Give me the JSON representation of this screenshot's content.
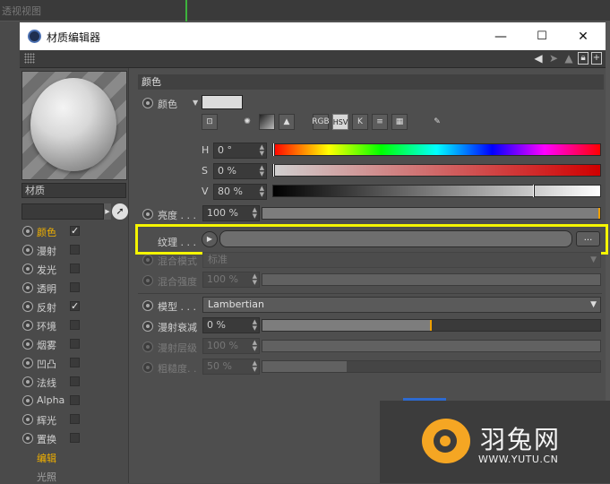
{
  "background": {
    "viewport_label": "透视视图"
  },
  "window": {
    "title": "材质编辑器",
    "controls": {
      "minimize": "—",
      "maximize": "☐",
      "close": "✕"
    }
  },
  "left_panel": {
    "material_name": "材质",
    "channels": [
      {
        "label": "颜色",
        "checked": true,
        "active": true
      },
      {
        "label": "漫射",
        "checked": false
      },
      {
        "label": "发光",
        "checked": false
      },
      {
        "label": "透明",
        "checked": false
      },
      {
        "label": "反射",
        "checked": true
      },
      {
        "label": "环境",
        "checked": false
      },
      {
        "label": "烟雾",
        "checked": false
      },
      {
        "label": "凹凸",
        "checked": false
      },
      {
        "label": "法线",
        "checked": false
      },
      {
        "label": "Alpha",
        "checked": false
      },
      {
        "label": "辉光",
        "checked": false
      },
      {
        "label": "置换",
        "checked": false
      }
    ],
    "sub_items": [
      "编辑",
      "光照"
    ]
  },
  "color_section": {
    "header": "颜色",
    "color_label": "颜色",
    "mode_buttons": [
      "RGB",
      "HSV",
      "K"
    ],
    "h": {
      "label": "H",
      "value": "0 °",
      "fraction": 0.0
    },
    "s": {
      "label": "S",
      "value": "0 %",
      "fraction": 0.0
    },
    "v": {
      "label": "V",
      "value": "80 %",
      "fraction": 0.8
    },
    "brightness": {
      "label": "亮度 . . .",
      "value": "100 %",
      "fraction": 1.0
    },
    "texture": {
      "label": "纹理 . . .",
      "more": "..."
    },
    "blend_mode": {
      "label": "混合模式",
      "value": "标准"
    },
    "blend_strength": {
      "label": "混合强度",
      "value": "100 %",
      "fraction": 1.0
    },
    "model": {
      "label": "模型 . . .",
      "value": "Lambertian"
    },
    "diffuse_falloff": {
      "label": "漫射衰减",
      "value": "0 %",
      "fraction": 0.5
    },
    "diffuse_level": {
      "label": "漫射层级",
      "value": "100 %",
      "fraction": 1.0
    },
    "roughness": {
      "label": "粗糙度. .",
      "value": "50 %",
      "fraction": 0.25
    }
  },
  "watermark": {
    "name": "羽兔网",
    "url": "WWW.YUTU.CN"
  },
  "colors": {
    "highlight": "#f5f500",
    "accent": "#f0b000",
    "logo": "#f5a623"
  }
}
